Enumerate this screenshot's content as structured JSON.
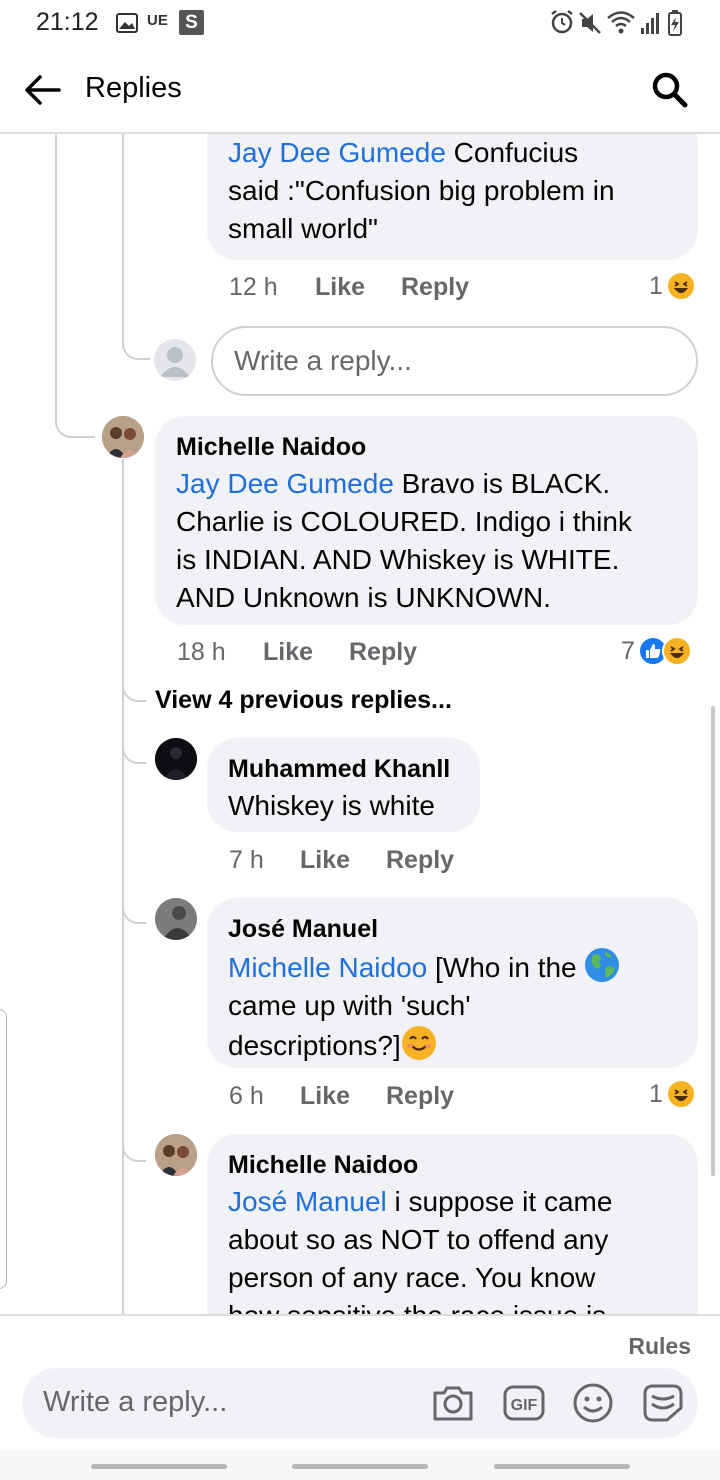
{
  "status_bar": {
    "time": "21:12",
    "carrier": "UE",
    "app_badge": "S"
  },
  "header": {
    "title": "Replies",
    "back_icon": "arrow-left-icon",
    "search_icon": "search-icon"
  },
  "thread": {
    "top_reply": {
      "mention": "Jay Dee Gumede",
      "text_line1": " Confucius",
      "text_line2": "said :\"Confusion big problem in",
      "text_line3": "small world\"",
      "time": "12 h",
      "like_label": "Like",
      "reply_label": "Reply",
      "reaction_count": "1",
      "reactions": [
        "haha"
      ]
    },
    "inline_reply_placeholder": "Write a reply...",
    "parent_comment": {
      "author": "Michelle Naidoo",
      "mention": "Jay Dee Gumede",
      "text_line1": " Bravo is BLACK.",
      "text_line2": "Charlie is COLOURED. Indigo i think",
      "text_line3": "is INDIAN. AND Whiskey is WHITE.",
      "text_line4": "AND Unknown is UNKNOWN.",
      "time": "18 h",
      "like_label": "Like",
      "reply_label": "Reply",
      "reaction_count": "7",
      "reactions": [
        "like",
        "haha"
      ]
    },
    "view_previous": "View 4 previous replies...",
    "replies": [
      {
        "author": "Muhammed Khanll",
        "text": "Whiskey is white",
        "time": "7 h",
        "like_label": "Like",
        "reply_label": "Reply"
      },
      {
        "author": "José Manuel",
        "mention": "Michelle Naidoo",
        "text_line1": " [Who in the ",
        "globe_emoji": "globe-emoji",
        "text_line2": "came up with 'such'",
        "text_line3": "descriptions?]",
        "smile_emoji": "smiling-face-emoji",
        "time": "6 h",
        "like_label": "Like",
        "reply_label": "Reply",
        "reaction_count": "1",
        "reactions": [
          "haha"
        ]
      },
      {
        "author": "Michelle Naidoo",
        "mention": "José Manuel",
        "text_line1": " i suppose it came",
        "text_line2": "about so as NOT to offend any",
        "text_line3": "person of any race. You know",
        "text_line4": "how sensitive the race issue is"
      }
    ]
  },
  "composer": {
    "rules_label": "Rules",
    "placeholder": "Write a reply...",
    "icons": [
      "camera-icon",
      "gif-icon",
      "emoji-icon",
      "sticker-icon"
    ]
  },
  "colors": {
    "mention": "#216fdb",
    "bubble": "#f0f2f5",
    "meta": "#65676b",
    "like": "#1877f2",
    "haha": "#f7b125"
  }
}
